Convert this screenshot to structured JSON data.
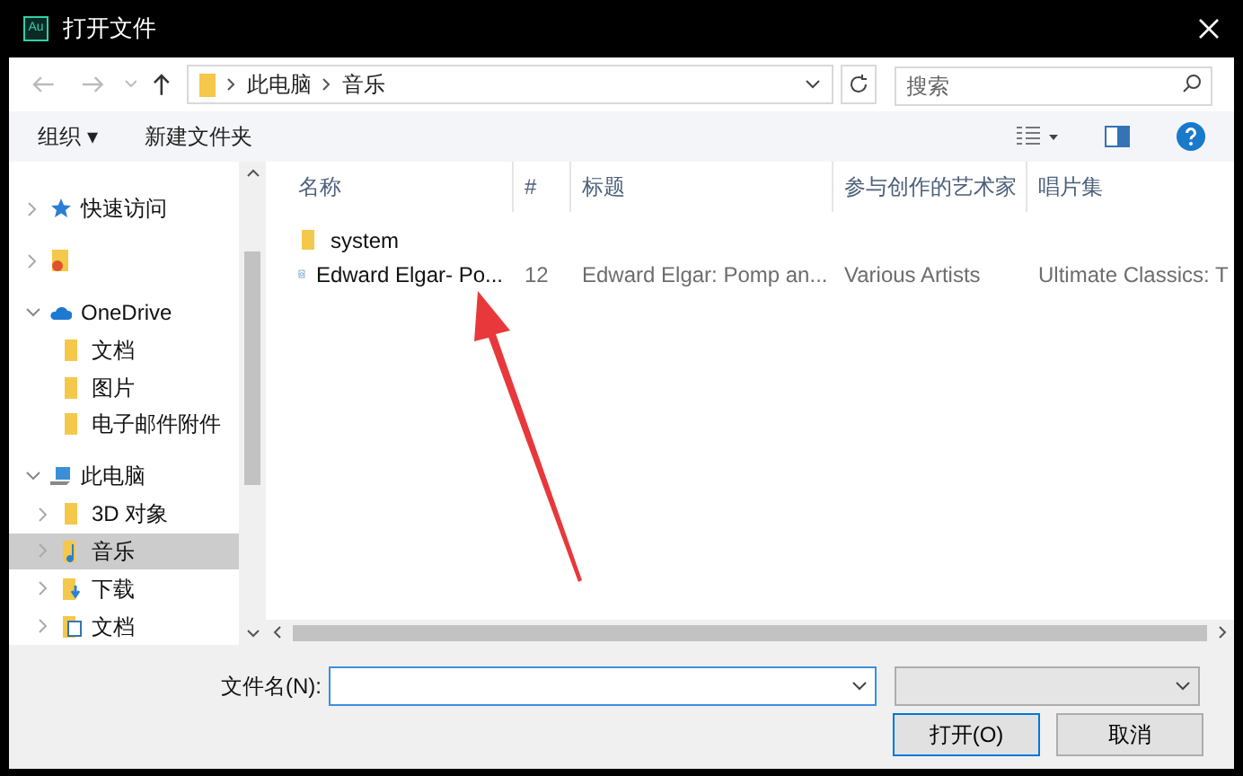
{
  "window": {
    "title": "打开文件",
    "app_icon": "Au"
  },
  "address_bar": {
    "path": [
      "此电脑",
      "音乐"
    ]
  },
  "search": {
    "placeholder": "搜索"
  },
  "toolbar": {
    "organize": "组织 ▾",
    "new_folder": "新建文件夹"
  },
  "sidebar": {
    "items": [
      {
        "label": "快速访问",
        "kind": "star",
        "expanded": false,
        "selected": false
      },
      {
        "kind": "user-folder",
        "expanded": false,
        "selected": false
      },
      {
        "label": "OneDrive",
        "kind": "cloud",
        "expanded": true,
        "selected": false,
        "children": [
          {
            "label": "文档",
            "kind": "folder",
            "selected": false
          },
          {
            "label": "图片",
            "kind": "folder",
            "selected": false
          },
          {
            "label": "电子邮件附件",
            "kind": "folder",
            "selected": false
          }
        ]
      },
      {
        "label": "此电脑",
        "kind": "computer",
        "expanded": true,
        "selected": false,
        "children": [
          {
            "label": "3D 对象",
            "kind": "folder",
            "expanded": false,
            "selected": false
          },
          {
            "label": "音乐",
            "kind": "music",
            "expanded": false,
            "selected": true
          },
          {
            "label": "下载",
            "kind": "download",
            "expanded": false,
            "selected": false
          },
          {
            "label": "文档",
            "kind": "document",
            "expanded": false,
            "selected": false
          }
        ]
      }
    ]
  },
  "file_list": {
    "columns": [
      "名称",
      "#",
      "标题",
      "参与创作的艺术家",
      "唱片集"
    ],
    "rows": [
      {
        "kind": "folder",
        "name": "system"
      },
      {
        "kind": "audio",
        "name": "Edward Elgar- Po...",
        "number": "12",
        "title": "Edward Elgar: Pomp an...",
        "artists": "Various Artists",
        "album": "Ultimate Classics: T"
      }
    ]
  },
  "filename": {
    "label": "文件名(N):"
  },
  "buttons": [
    "打开(O)",
    "取消"
  ]
}
